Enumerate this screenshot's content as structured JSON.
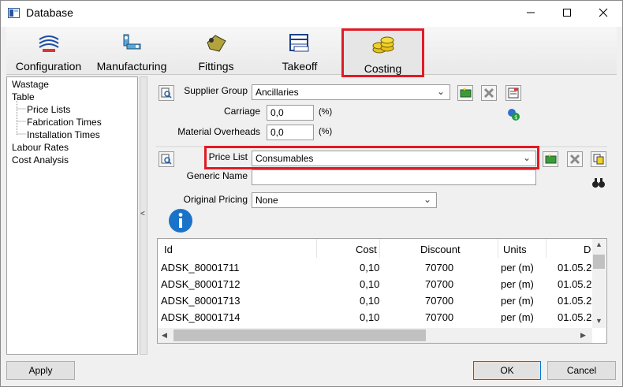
{
  "window": {
    "title": "Database"
  },
  "toolbar": {
    "tabs": [
      {
        "label": "Configuration",
        "icon": "configuration-icon"
      },
      {
        "label": "Manufacturing",
        "icon": "manufacturing-icon"
      },
      {
        "label": "Fittings",
        "icon": "fittings-icon"
      },
      {
        "label": "Takeoff",
        "icon": "takeoff-icon"
      },
      {
        "label": "Costing",
        "icon": "coins-icon",
        "selected": true
      }
    ]
  },
  "nav": {
    "items": [
      {
        "label": "Wastage"
      },
      {
        "label": "Table"
      },
      {
        "label": "Price Lists",
        "selected": true
      },
      {
        "label": "Fabrication Times"
      },
      {
        "label": "Installation Times"
      },
      {
        "label": "Labour Rates"
      },
      {
        "label": "Cost Analysis"
      }
    ]
  },
  "form": {
    "supplier_group": {
      "label": "Supplier Group",
      "value": "Ancillaries"
    },
    "carriage": {
      "label": "Carriage",
      "value": "0,0",
      "unit": "(%)"
    },
    "material_overheads": {
      "label": "Material Overheads",
      "value": "0,0",
      "unit": "(%)"
    },
    "price_list": {
      "label": "Price List",
      "value": "Consumables"
    },
    "generic_name": {
      "label": "Generic Name",
      "value": ""
    },
    "original_pricing": {
      "label": "Original Pricing",
      "value": "None"
    }
  },
  "grid": {
    "columns": [
      "Id",
      "Cost",
      "Discount",
      "Units",
      "D"
    ],
    "rows": [
      [
        "ADSK_80001711",
        "0,10",
        "70700",
        "per (m)",
        "01.05.2"
      ],
      [
        "ADSK_80001712",
        "0,10",
        "70700",
        "per (m)",
        "01.05.2"
      ],
      [
        "ADSK_80001713",
        "0,10",
        "70700",
        "per (m)",
        "01.05.2"
      ],
      [
        "ADSK_80001714",
        "0,10",
        "70700",
        "per (m)",
        "01.05.2"
      ]
    ]
  },
  "buttons": {
    "apply": "Apply",
    "ok": "OK",
    "cancel": "Cancel"
  },
  "colors": {
    "highlight": "#e01b24",
    "info": "#1a73c9"
  }
}
